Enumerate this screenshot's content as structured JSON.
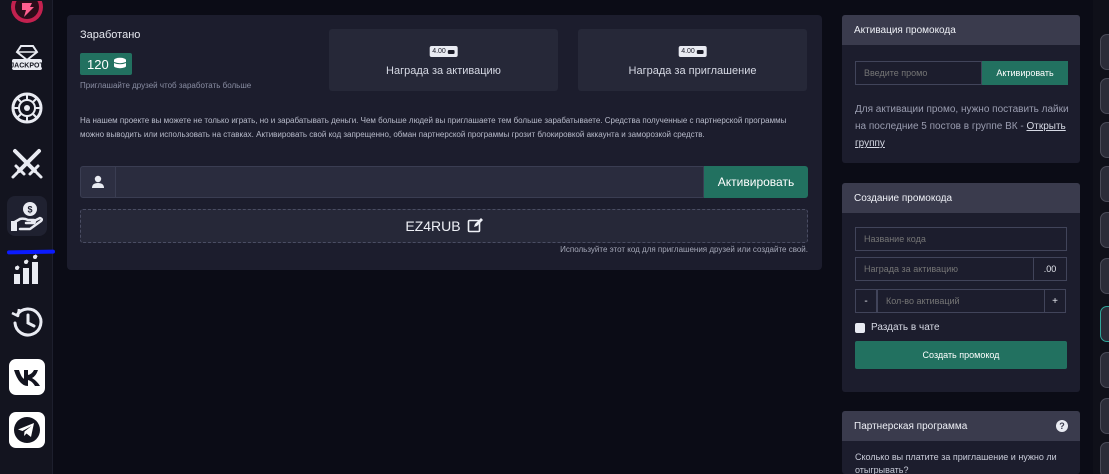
{
  "sidebar": {
    "items": [
      {
        "name": "games-logo-icon"
      },
      {
        "name": "jackpot-icon",
        "label": "JACKPOT"
      },
      {
        "name": "roulette-wheel-icon"
      },
      {
        "name": "crossed-swords-icon"
      },
      {
        "name": "partner-money-hand-icon"
      },
      {
        "name": "leaderboard-icon"
      },
      {
        "name": "history-clock-icon"
      },
      {
        "name": "vk-icon"
      },
      {
        "name": "telegram-icon"
      }
    ],
    "active_index": 4,
    "annotation_color": "#0b1bff"
  },
  "earned": {
    "title": "Заработано",
    "amount": "120",
    "hint": "Приглашайте друзей чтоб заработать больше"
  },
  "rewards": [
    {
      "value": "4.00",
      "label": "Награда за активацию"
    },
    {
      "value": "4.00",
      "label": "Награда за приглашение"
    }
  ],
  "description": "На нашем проекте вы можете не только играть, но и зарабатывать деньги. Чем больше людей вы приглашаете тем больше зарабатываете. Средства полученные с партнерской программы можно выводить или использовать на ставках. Активировать свой код запрещенно, обман партнерской программы грозит блокировкой аккаунта и заморозкой средств.",
  "code_form": {
    "input_value": "",
    "button_label": "Активировать"
  },
  "promo_code": {
    "code": "EZ4RUB",
    "hint": "Используйте этот код для приглашения друзей или создайте свой."
  },
  "activation_card": {
    "title": "Активация промокода",
    "placeholder": "Введите промо",
    "button_label": "Активировать",
    "text": "Для активации промо, нужно поставить лайки на последние 5 постов в группе ВК -",
    "link_label": "Открыть группу"
  },
  "create_card": {
    "title": "Создание промокода",
    "name_placeholder": "Название кода",
    "reward_placeholder": "Награда за активацию",
    "reward_suffix": ".00",
    "count_placeholder": "Кол-во активаций",
    "minus_label": "-",
    "plus_label": "+",
    "chat_label": "Раздать в чате",
    "button_label": "Создать промокод"
  },
  "partner_card": {
    "title": "Партнерская программа",
    "help_label": "?",
    "question": "Сколько вы платите за приглашение и нужно ли отыгрывать?"
  },
  "colors": {
    "accent": "#227160",
    "panel": "#1c1d2d",
    "background": "#0b0c16"
  }
}
